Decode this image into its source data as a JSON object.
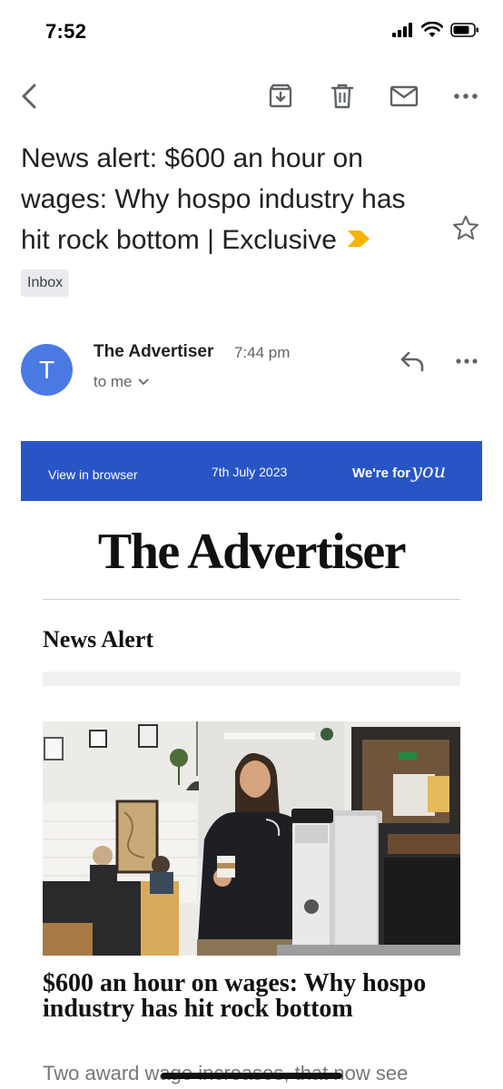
{
  "status_bar": {
    "time": "7:52"
  },
  "email": {
    "subject": "News alert: $600 an hour on wages: Why hospo industry has hit rock bottom | Exclusive",
    "label": "Inbox",
    "sender": {
      "initial": "T",
      "name": "The Advertiser",
      "time": "7:44 pm",
      "recipient": "to me"
    }
  },
  "newsletter": {
    "banner": {
      "view_in_browser": "View in browser",
      "date": "7th July 2023",
      "tagline_prefix": "We're for",
      "tagline_script": "you"
    },
    "masthead": "The Advertiser",
    "section_title": "News Alert",
    "article": {
      "headline": "$600 an hour on wages: Why hospo industry has hit rock bottom",
      "teaser": "Two award wage increases, that now see"
    }
  },
  "colors": {
    "banner_blue": "#2855c5",
    "avatar_blue": "#4b79e4",
    "importance_yellow": "#f4b400"
  },
  "icons": [
    "back-arrow-icon",
    "archive-icon",
    "trash-icon",
    "mail-icon",
    "more-horizontal-icon",
    "star-icon",
    "reply-icon",
    "chevron-down-icon",
    "importance-marker-icon",
    "signal-icon",
    "wifi-icon",
    "battery-icon"
  ]
}
